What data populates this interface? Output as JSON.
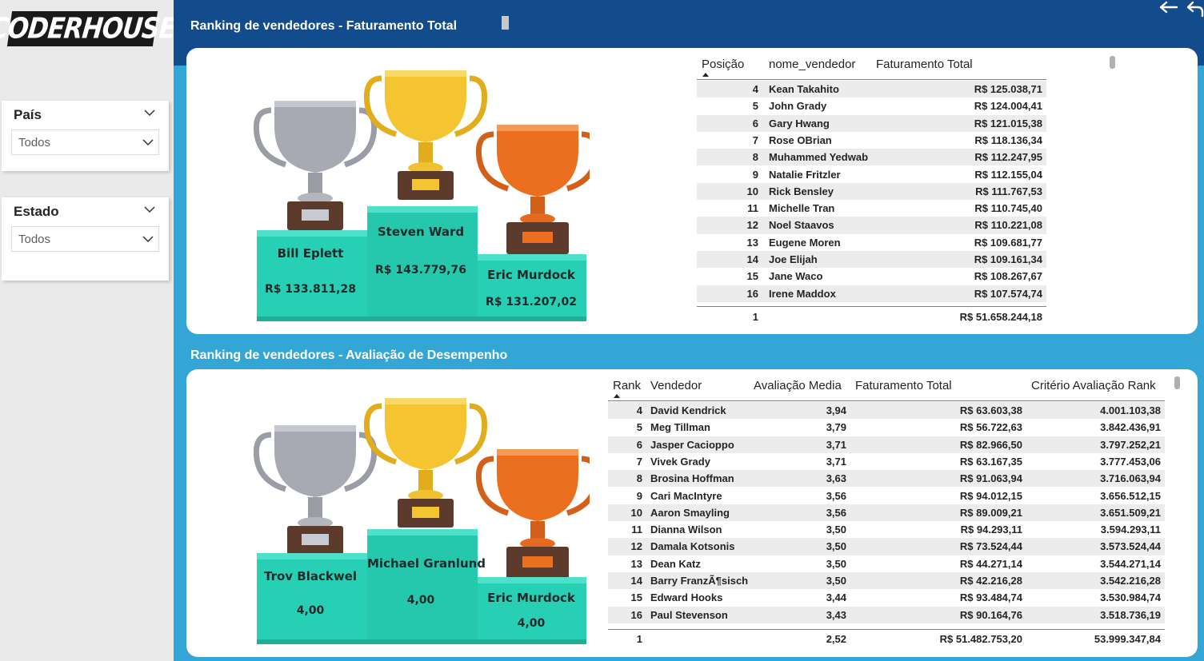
{
  "logo": {
    "text": "CODERHOUSE"
  },
  "filters": [
    {
      "title": "País",
      "value": "Todos"
    },
    {
      "title": "Estado",
      "value": "Todos"
    }
  ],
  "colors": {
    "topbar": "#124c8c",
    "background": "#34a6d6",
    "podium": "#27cfb4",
    "silver": "#a8aab3",
    "gold": "#f5c431",
    "bronze": "#ec6f20"
  },
  "section1": {
    "title": "Ranking de vendedores - Faturamento Total",
    "podium": {
      "second": {
        "name": "Bill Eplett",
        "value": "R$ 133.811,28"
      },
      "first": {
        "name": "Steven Ward",
        "value": "R$ 143.779,76"
      },
      "third": {
        "name": "Eric Murdock",
        "value": "R$ 131.207,02"
      }
    },
    "table": {
      "headers": [
        "Posição",
        "nome_vendedor",
        "Faturamento Total"
      ],
      "rows": [
        [
          "4",
          "Kean Takahito",
          "R$ 125.038,71"
        ],
        [
          "5",
          "John Grady",
          "R$ 124.004,41"
        ],
        [
          "6",
          "Gary Hwang",
          "R$ 121.015,38"
        ],
        [
          "7",
          "Rose OBrian",
          "R$ 118.136,34"
        ],
        [
          "8",
          "Muhammed Yedwab",
          "R$ 112.247,95"
        ],
        [
          "9",
          "Natalie Fritzler",
          "R$ 112.155,04"
        ],
        [
          "10",
          "Rick Bensley",
          "R$ 111.767,53"
        ],
        [
          "11",
          "Michelle Tran",
          "R$ 110.745,40"
        ],
        [
          "12",
          "Noel Staavos",
          "R$ 110.221,08"
        ],
        [
          "13",
          "Eugene Moren",
          "R$ 109.681,77"
        ],
        [
          "14",
          "Joe Elijah",
          "R$ 109.161,34"
        ],
        [
          "15",
          "Jane Waco",
          "R$ 108.267,67"
        ],
        [
          "16",
          "Irene Maddox",
          "R$ 107.574,74"
        ]
      ],
      "total": [
        "1",
        "",
        "R$ 51.658.244,18"
      ]
    }
  },
  "section2": {
    "title": "Ranking de vendedores - Avaliação de Desempenho",
    "podium": {
      "second": {
        "name": "Trov Blackwel",
        "value": "4,00"
      },
      "first": {
        "name": "Michael Granlund",
        "value": "4,00"
      },
      "third": {
        "name": "Eric Murdock",
        "value": "4,00"
      }
    },
    "table": {
      "headers": [
        "Rank",
        "Vendedor",
        "Avaliação Media",
        "Faturamento Total",
        "Critério Avaliação Rank"
      ],
      "rows": [
        [
          "4",
          "David Kendrick",
          "3,94",
          "R$ 63.603,38",
          "4.001.103,38"
        ],
        [
          "5",
          "Meg Tillman",
          "3,79",
          "R$ 56.722,63",
          "3.842.436,91"
        ],
        [
          "6",
          "Jasper Cacioppo",
          "3,71",
          "R$ 82.966,50",
          "3.797.252,21"
        ],
        [
          "7",
          "Vivek Grady",
          "3,71",
          "R$ 63.167,35",
          "3.777.453,06"
        ],
        [
          "8",
          "Brosina Hoffman",
          "3,63",
          "R$ 91.063,94",
          "3.716.063,94"
        ],
        [
          "9",
          "Cari MacIntyre",
          "3,56",
          "R$ 94.012,15",
          "3.656.512,15"
        ],
        [
          "10",
          "Aaron Smayling",
          "3,56",
          "R$ 89.009,21",
          "3.651.509,21"
        ],
        [
          "11",
          "Dianna Wilson",
          "3,50",
          "R$ 94.293,11",
          "3.594.293,11"
        ],
        [
          "12",
          "Damala Kotsonis",
          "3,50",
          "R$ 73.524,44",
          "3.573.524,44"
        ],
        [
          "13",
          "Dean Katz",
          "3,50",
          "R$ 44.271,14",
          "3.544.271,14"
        ],
        [
          "14",
          "Barry FranzÃ¶sisch",
          "3,50",
          "R$ 42.216,28",
          "3.542.216,28"
        ],
        [
          "15",
          "Edward Hooks",
          "3,44",
          "R$ 93.484,74",
          "3.530.984,74"
        ],
        [
          "16",
          "Paul Stevenson",
          "3,43",
          "R$ 90.164,76",
          "3.518.736,19"
        ]
      ],
      "total": [
        "1",
        "",
        "2,52",
        "R$ 51.482.753,20",
        "53.999.347,84"
      ]
    }
  }
}
